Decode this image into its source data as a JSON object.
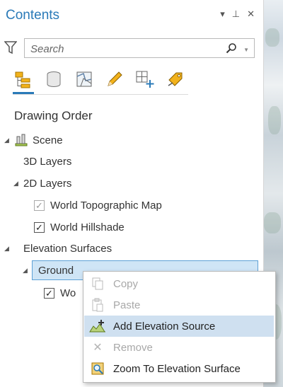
{
  "panel": {
    "title": "Contents",
    "controls": {
      "menu": "▾",
      "pin": "⊥",
      "close": "✕"
    }
  },
  "search": {
    "placeholder": "Search"
  },
  "toolbar": {
    "icons": [
      "list-by-drawing-order-icon",
      "list-by-data-source-icon",
      "list-by-selection-icon",
      "list-by-editing-icon",
      "list-by-snapping-icon",
      "list-by-labeling-icon"
    ]
  },
  "drawing_order": {
    "heading": "Drawing Order",
    "scene": "Scene",
    "layers_3d": "3D Layers",
    "layers_2d": "2D Layers",
    "world_topo": "World Topographic Map",
    "world_hillshade": "World Hillshade",
    "elevation_surfaces": "Elevation Surfaces",
    "ground": "Ground",
    "ground_child": "Wo"
  },
  "context_menu": {
    "copy": "Copy",
    "paste": "Paste",
    "add_elevation_source": "Add Elevation Source",
    "remove": "Remove",
    "zoom_to_surface": "Zoom To Elevation Surface"
  },
  "colors": {
    "accent": "#2a7ab8",
    "selection": "#cfe5f6",
    "menu_highlight": "#cfe0f0"
  }
}
